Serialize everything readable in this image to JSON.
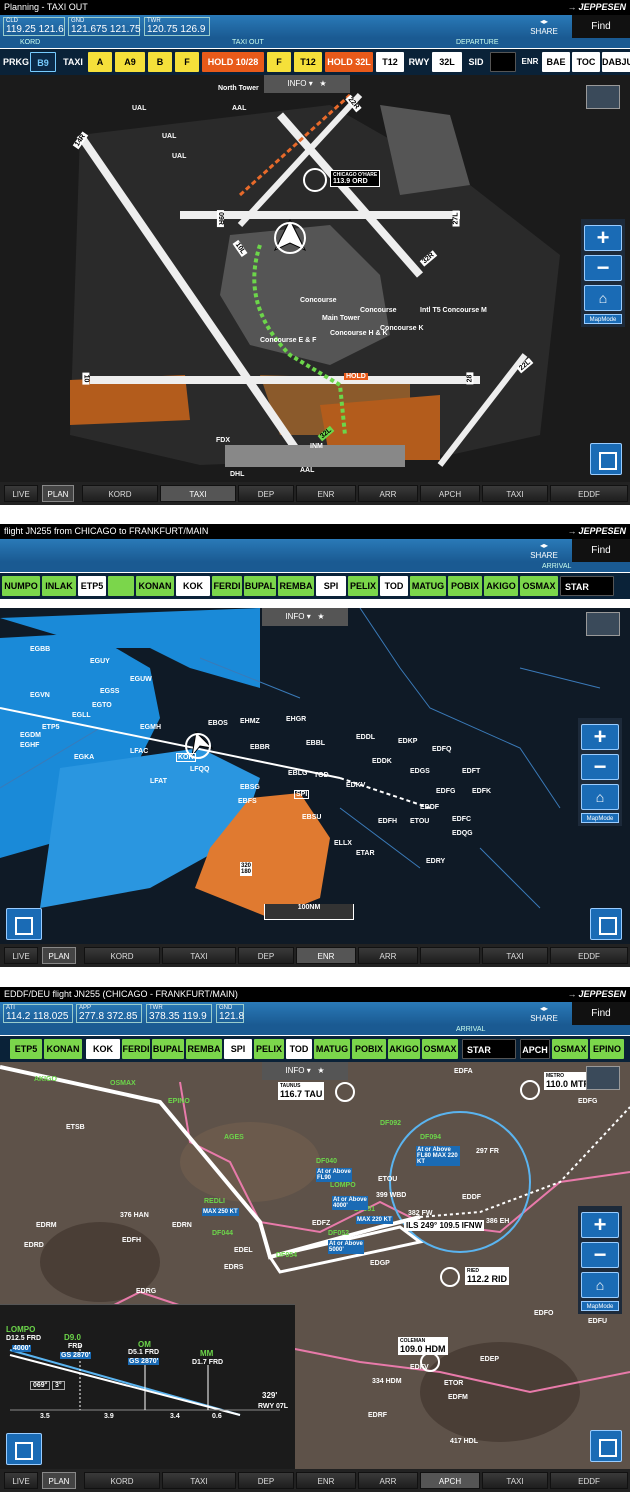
{
  "brand": "JEPPESEN",
  "share": "SHARE",
  "find": "Find",
  "info": "INFO",
  "mapmode": "MapMode",
  "panel1": {
    "title": "Planning - TAXI OUT",
    "freqs": [
      {
        "l": "CLD",
        "v": "119.25 121.6"
      },
      {
        "l": "GND",
        "v": "121.675 121.75"
      },
      {
        "l": "TWR",
        "v": "120.75 126.9"
      }
    ],
    "hdr": {
      "kord": "KORD",
      "taxiout": "TAXI OUT",
      "departure": "DEPARTURE"
    },
    "strip": {
      "prkg": "PRKG",
      "stand": "B9",
      "taxi": "TAXI",
      "route": [
        "A",
        "A9",
        "B",
        "F"
      ],
      "hold1": "HOLD 10/28",
      "f": "F",
      "t12a": "T12",
      "hold2": "HOLD 32L",
      "t12b": "T12",
      "rwy": "RWY",
      "rwyval": "32L",
      "sid": "SID",
      "enr": "ENR",
      "bae": "BAE",
      "toc": "TOC",
      "dabju": "DABJU"
    },
    "airport": {
      "freq": "113.9 ORD",
      "name": "CHICAGO O'HARE",
      "runways": [
        "14R",
        "09R",
        "10L",
        "27L",
        "32R",
        "22R",
        "10",
        "28",
        "22L",
        "32L",
        "4L"
      ],
      "terminal": [
        "Concourse",
        "Concourse H & K",
        "Concourse E & F",
        "Concourse",
        "Main Tower",
        "Concourse K",
        "Intl T5 Concourse M"
      ],
      "labels": [
        "North Tower",
        "UAL",
        "AAL",
        "UAL",
        "UAL",
        "FDX",
        "INM",
        "AAL",
        "DHL"
      ],
      "hold": "HOLD"
    },
    "toolbar": [
      "LIVE",
      "PLAN",
      "KORD",
      "TAXI",
      "DEP",
      "ENR",
      "ARR",
      "APCH",
      "TAXI",
      "EDDF"
    ]
  },
  "panel2": {
    "title": "flight JN255 from CHICAGO to FRANKFURT/MAIN",
    "arrival": "ARRIVAL",
    "route": [
      "NUMPO",
      "INLAK",
      "ETP5",
      "",
      "KONAN",
      "KOK",
      "FERDI",
      "BUPAL",
      "REMBA",
      "SPI",
      "PELIX",
      "TOD",
      "MATUG",
      "POBIX",
      "AKIGO",
      "OSMAX"
    ],
    "star": "STAR",
    "airports": [
      "EGBB",
      "EGUY",
      "EGUW",
      "EGVN",
      "EGSS",
      "EGTO",
      "EGLL",
      "ETP5",
      "EGDM",
      "EGHF",
      "EGMH",
      "EGKA",
      "LFAC",
      "LFAT",
      "KOK",
      "LFQQ",
      "EBOS",
      "EHMZ",
      "EHGR",
      "EBBR",
      "EBBL",
      "EBLG",
      "EBSG",
      "EBFS",
      "EBSU",
      "EDDL",
      "EDKP",
      "EDDK",
      "EDFQ",
      "EDGS",
      "EDFT",
      "EDKV",
      "TOD",
      "EDFG",
      "EDFK",
      "EDDF",
      "EDFH",
      "ETOU",
      "EDFC",
      "EDQG",
      "ELLX",
      "ETAR",
      "EDRY",
      "SPI"
    ],
    "scale": "100NM",
    "tfr": [
      "320",
      "180"
    ],
    "toolbar": [
      "LIVE",
      "PLAN",
      "KORD",
      "TAXI",
      "DEP",
      "ENR",
      "ARR",
      "TAXI",
      "EDDF"
    ]
  },
  "panel3": {
    "title": "EDDF/DEU flight JN255 (CHICAGO - FRANKFURT/MAIN)",
    "freqs": [
      {
        "l": "ATI",
        "v": "114.2 118.025"
      },
      {
        "l": "APP",
        "v": "277.8 372.85"
      },
      {
        "l": "TWR",
        "v": "378.35 119.9"
      },
      {
        "l": "GND",
        "v": "121.8"
      }
    ],
    "arrival": "ARRIVAL",
    "route": [
      "ETP5",
      "KONAN",
      "KOK",
      "FERDI",
      "BUPAL",
      "REMBA",
      "SPI",
      "PELIX",
      "TOD",
      "MATUG",
      "POBIX",
      "AKIGO",
      "OSMAX"
    ],
    "star": "STAR",
    "apch": [
      "APCH",
      "OSMAX",
      "EPINO"
    ],
    "vor": {
      "taunus": "TAUNUS",
      "tau": "116.7 TAU",
      "metro": "METRO",
      "mtr": "110.0 MTR",
      "ried": "RIED",
      "rid": "112.2 RID",
      "coleman": "COLEMAN",
      "hdm": "109.0 HDM"
    },
    "ils": "ILS 249° 109.5 IFNW",
    "fixes": [
      "AKIGO",
      "OSMAX",
      "EPINO",
      "EDFA",
      "EDFG",
      "ETSB",
      "AGES",
      "DF092",
      "DF094",
      "297 FR",
      "EDRM",
      "376 HAN",
      "EDRN",
      "REDLI",
      "DF040",
      "LOMPO",
      "ETOU",
      "399 WBD",
      "382 FW",
      "EDDF",
      "386 EH",
      "EDFH",
      "DF044",
      "EDFZ",
      "DF051",
      "DF052",
      "EDEL",
      "DF054",
      "EDRD",
      "EDRS",
      "EDGP",
      "EDRG",
      "EDFO",
      "EDFU",
      "EDFV",
      "EDEP",
      "ETOR",
      "334 HDM",
      "EDFM",
      "EDRF",
      "417 HDL"
    ],
    "constraints": [
      "At or Above FL80 MAX 220 KT",
      "At or Above FL90",
      "At or Above 4000'",
      "At or Above 5000'",
      "MAX 250 KT",
      "MAX 220 KT"
    ],
    "profile": {
      "lompo": "LOMPO",
      "lompo_d": "D12.5 FRD",
      "lompo_alt": "4000'",
      "d9": "D9.0",
      "d9frd": "FRD",
      "d9spd": "GS 2870'",
      "om": "OM",
      "om_d": "D5.1 FRD",
      "om_spd": "GS 2870'",
      "mm": "MM",
      "mm_d": "D1.7 FRD",
      "angle1": "069°",
      "angle2": "3°",
      "rwy": "329'",
      "rwyl": "RWY 07L",
      "dists": [
        "3.5",
        "3.9",
        "3.4",
        "0.6"
      ]
    },
    "toolbar": [
      "LIVE",
      "PLAN",
      "KORD",
      "TAXI",
      "DEP",
      "ENR",
      "ARR",
      "APCH",
      "TAXI",
      "EDDF"
    ]
  }
}
